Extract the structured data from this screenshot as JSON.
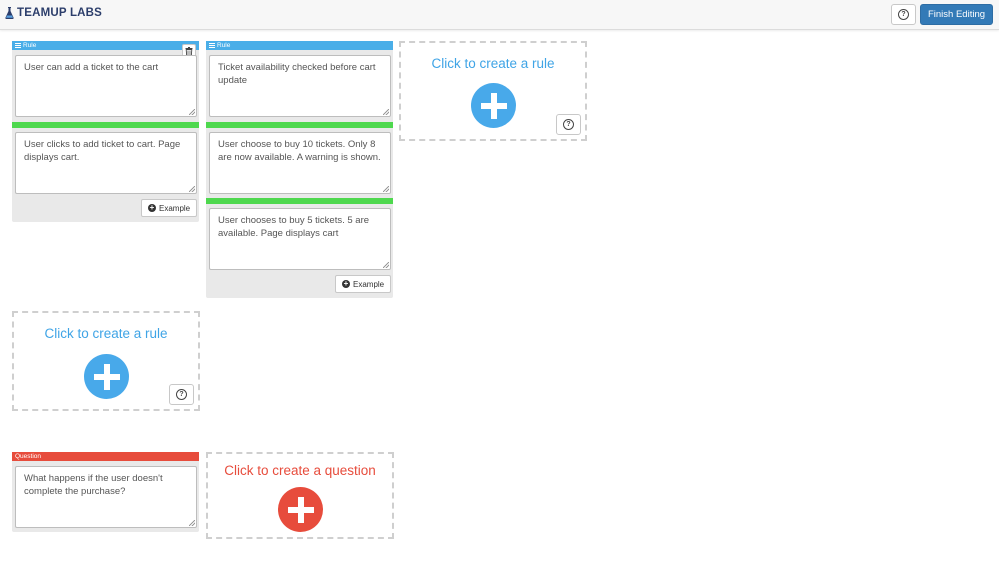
{
  "header": {
    "brand": "TEAMUP LABS",
    "help_icon": "question-circle-icon",
    "finish_label": "Finish Editing",
    "accent": "#337ab7"
  },
  "rules": [
    {
      "header_label": "Rule",
      "rule_text": "User can add a ticket to the cart",
      "examples": [
        "User clicks to add ticket to cart. Page displays cart."
      ],
      "example_button": "Example"
    },
    {
      "header_label": "Rule",
      "rule_text": "Ticket availability checked before cart update",
      "examples": [
        "User choose to buy 10 tickets. Only 8 are now available. A warning is shown.",
        "User chooses to buy 5 tickets. 5 are available. Page displays cart"
      ],
      "example_button": "Example"
    }
  ],
  "create_rule_label": "Click to create a rule",
  "question": {
    "header_label": "Question",
    "text": "What happens if the user doesn't complete the purchase?"
  },
  "create_question_label": "Click to create a question",
  "colors": {
    "rule_blue": "#4aaee8",
    "example_green": "#4ed84e",
    "question_red": "#e74c3c"
  }
}
